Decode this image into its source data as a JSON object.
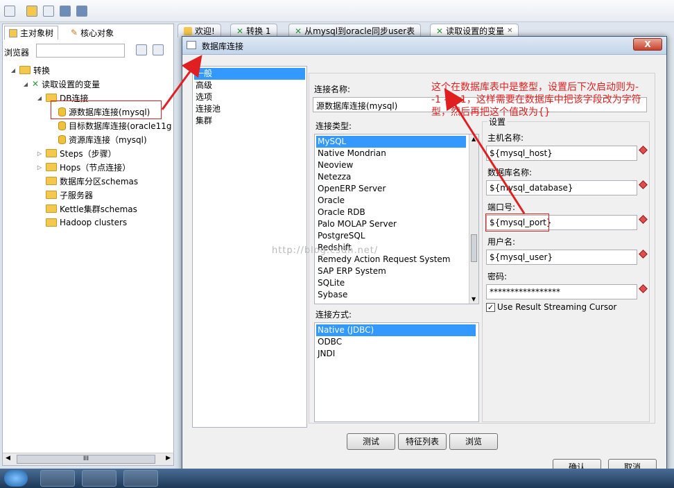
{
  "left_pane": {
    "tabs": [
      "主对象树",
      "核心对象"
    ],
    "browser_label": "浏览器",
    "tree": {
      "root": "转换",
      "transformation": "读取设置的变量",
      "db_folder": "DB连接",
      "connections": [
        "源数据库连接(mysql)",
        "目标数据库连接(oracle11g",
        "资源库连接（mysql)"
      ],
      "folders": [
        "Steps（步骤）",
        "Hops（节点连接）",
        "数据库分区schemas",
        "子服务器",
        "Kettle集群schemas",
        "Hadoop clusters"
      ]
    },
    "hscroll_grip": "III"
  },
  "editor_tabs": [
    "欢迎!",
    "转换 1",
    "从mysql到oracle同步user表",
    "读取设置的变量"
  ],
  "dialog": {
    "title": "数据库连接",
    "close_glyph": "X",
    "nav": [
      "一般",
      "高级",
      "选项",
      "连接池",
      "集群"
    ],
    "conn_name_label": "连接名称:",
    "conn_name_value": "源数据库连接(mysql)",
    "conn_type_label": "连接类型:",
    "conn_types": [
      "MySQL",
      "Native Mondrian",
      "Neoview",
      "Netezza",
      "OpenERP Server",
      "Oracle",
      "Oracle RDB",
      "Palo MOLAP Server",
      "PostgreSQL",
      "Redshift",
      "Remedy Action Request System",
      "SAP ERP System",
      "SQLite",
      "Sybase"
    ],
    "access_label": "连接方式:",
    "access_types": [
      "Native (JDBC)",
      "ODBC",
      "JNDI"
    ],
    "settings": {
      "group": "设置",
      "host_label": "主机名称:",
      "host_value": "${mysql_host}",
      "db_label": "数据库名称:",
      "db_value": "${mysql_database}",
      "port_label": "端口号:",
      "port_value": "${mysql_port}",
      "user_label": "用户名:",
      "user_value": "${mysql_user}",
      "pwd_label": "密码:",
      "pwd_value": "*****************",
      "streaming_label": "Use Result Streaming Cursor",
      "streaming_checked": true
    },
    "buttons": {
      "test": "测试",
      "features": "特征列表",
      "browse": "浏览",
      "ok": "确认",
      "cancel": "取消"
    }
  },
  "annotation": {
    "line1": "这个在数据库表中是整型，设置后下次启动则为-",
    "line2": "-1 -1 -1，这样需要在数据库中把该字段改为字符",
    "line3": "型，然后再把这个值改为{}"
  },
  "watermark": "http://blog.csdn.net/",
  "colors": {
    "selection": "#3399ff",
    "annotation": "#e02020"
  }
}
